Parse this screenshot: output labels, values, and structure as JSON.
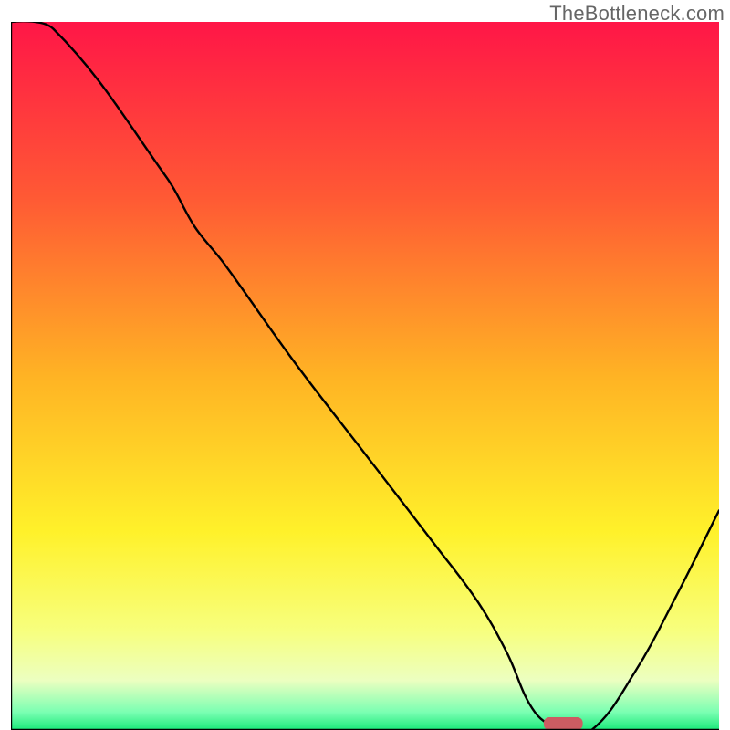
{
  "watermark": "TheBottleneck.com",
  "colors": {
    "gradient_stops": [
      {
        "offset": 0.0,
        "color": "#ff1647"
      },
      {
        "offset": 0.25,
        "color": "#ff5a34"
      },
      {
        "offset": 0.5,
        "color": "#ffb324"
      },
      {
        "offset": 0.72,
        "color": "#fff12a"
      },
      {
        "offset": 0.86,
        "color": "#f7ff7e"
      },
      {
        "offset": 0.93,
        "color": "#ecffc0"
      },
      {
        "offset": 0.975,
        "color": "#7affb2"
      },
      {
        "offset": 1.0,
        "color": "#1ae87a"
      }
    ],
    "axis": "#000000",
    "curve": "#000000",
    "marker": "#cc5c62"
  },
  "chart_data": {
    "type": "line",
    "title": "",
    "xlabel": "",
    "ylabel": "",
    "xlim": [
      0,
      100
    ],
    "ylim": [
      0,
      100
    ],
    "x": [
      0,
      6,
      22,
      26,
      30,
      40,
      50,
      60,
      66,
      70,
      74,
      78,
      82,
      88,
      94,
      100
    ],
    "values": [
      100,
      99,
      78,
      71,
      66,
      52,
      39,
      26,
      18,
      11,
      2.5,
      0,
      0,
      8,
      19,
      31
    ],
    "marker": {
      "x": 78,
      "y": 0,
      "width": 5.5,
      "height": 1.8
    }
  }
}
